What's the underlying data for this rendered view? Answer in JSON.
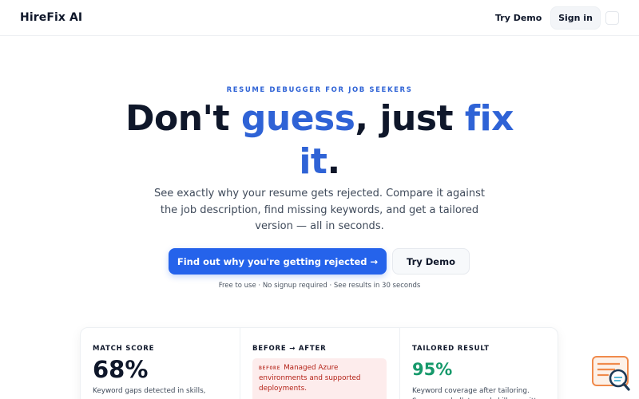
{
  "header": {
    "logo": "HireFix AI",
    "nav_demo": "Try Demo",
    "nav_signin": "Sign in"
  },
  "hero": {
    "eyebrow": "RESUME DEBUGGER FOR JOB SEEKERS",
    "headline_part1": "Don't ",
    "headline_accent1": "guess",
    "headline_part2": ", just ",
    "headline_accent2": "fix",
    "headline_accent3": "it",
    "headline_end": ".",
    "subtext": "See exactly why your resume gets rejected. Compare it against the job description, find missing keywords, and get a tailored version — all in seconds.",
    "cta_primary": "Find out why you're getting rejected →",
    "cta_secondary": "Try Demo",
    "footnote": "Free to use · No signup required · See results in 30 seconds"
  },
  "stats": {
    "match": {
      "label": "MATCH SCORE",
      "value": "68%",
      "desc": "Keyword gaps detected in skills,"
    },
    "before_after": {
      "label": "BEFORE → AFTER",
      "before_tag": "BEFORE",
      "before_text": "Managed Azure environments and supported deployments."
    },
    "tailored": {
      "label": "TAILORED RESULT",
      "value": "95%",
      "desc": "Keyword coverage after tailoring. Summary, bullets, and skills rewritten"
    }
  },
  "colors": {
    "accent": "#2563eb",
    "success": "#16996b",
    "error": "#b42318"
  },
  "widget": {
    "icon": "search-chat-icon"
  }
}
